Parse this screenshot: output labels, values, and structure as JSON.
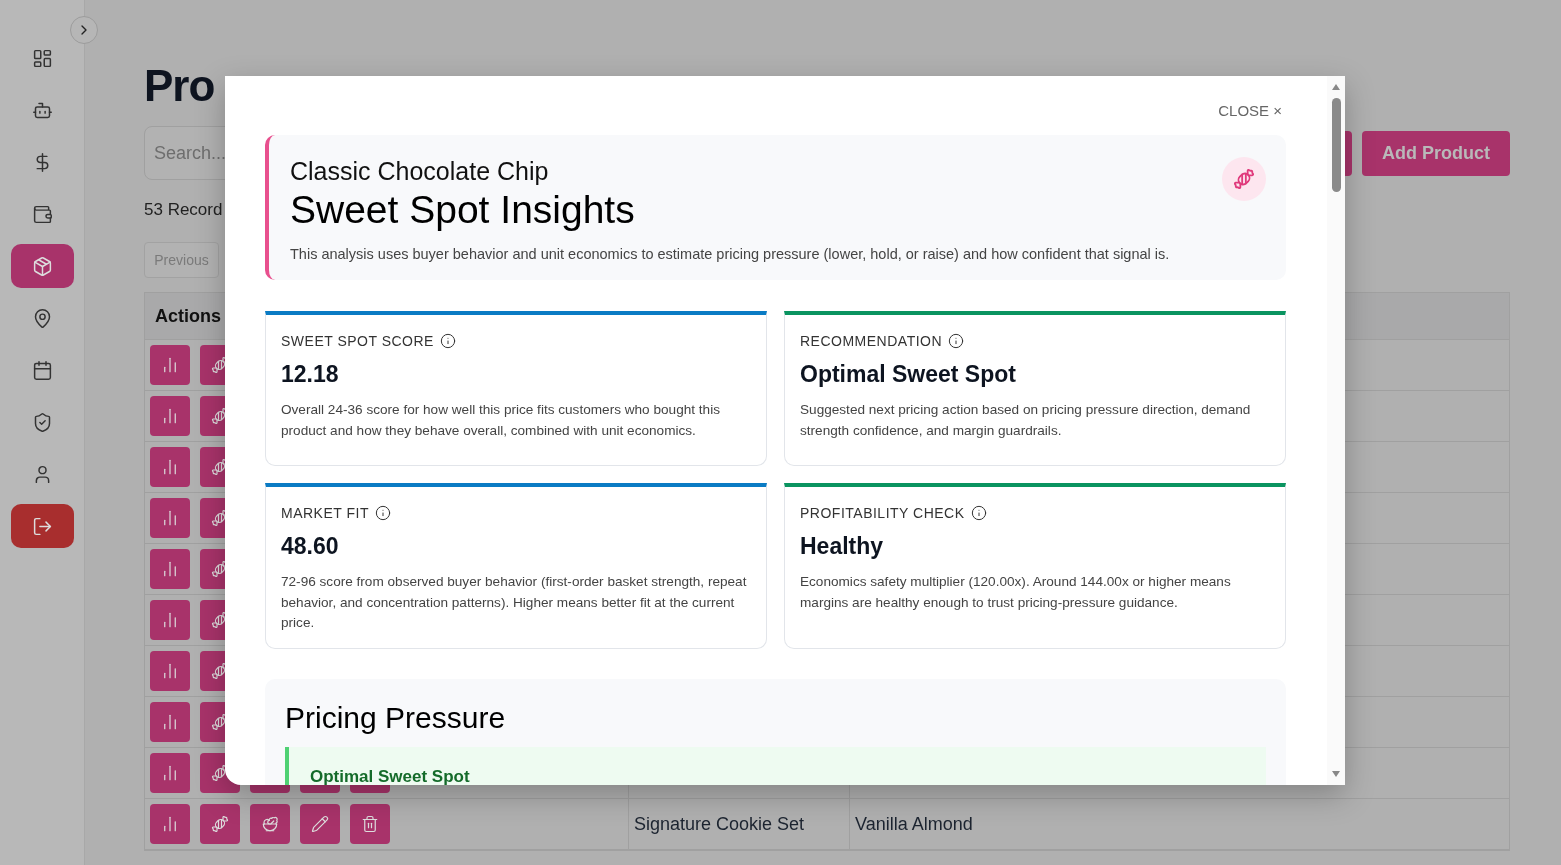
{
  "sidebar": {
    "items": [
      {
        "kind": "nav",
        "selected": false
      },
      {
        "kind": "nav",
        "selected": false
      },
      {
        "kind": "nav",
        "selected": false
      },
      {
        "kind": "nav",
        "selected": false
      },
      {
        "kind": "nav",
        "selected": true
      },
      {
        "kind": "nav",
        "selected": false
      },
      {
        "kind": "nav",
        "selected": false
      },
      {
        "kind": "nav",
        "selected": false
      },
      {
        "kind": "nav",
        "selected": false
      },
      {
        "kind": "logout"
      }
    ]
  },
  "page": {
    "title": "Pro",
    "search": {
      "placeholder": "Search..."
    },
    "record_count": "53 Record",
    "previous_button": "Previous",
    "add_button": "Add Product"
  },
  "table": {
    "columns": [
      "Actions"
    ],
    "rows": [
      {},
      {},
      {},
      {},
      {},
      {},
      {},
      {},
      {},
      {
        "column_2": "Signature Cookie Set",
        "column_3": "Vanilla Almond"
      }
    ]
  },
  "modal": {
    "close": "CLOSE ×",
    "product": "Classic Chocolate Chip",
    "title": "Sweet Spot Insights",
    "description": "This analysis uses buyer behavior and unit economics to estimate pricing pressure (lower, hold, or raise) and how confident that signal is.",
    "cards": [
      {
        "label": "SWEET SPOT SCORE",
        "value": "12.18",
        "color": "#0a7bc4",
        "description": "Overall 24-36 score for how well this price fits customers who bought this product and how they behave overall, combined with unit economics."
      },
      {
        "label": "RECOMMENDATION",
        "value": "Optimal Sweet Spot",
        "color": "#0a9460",
        "description": "Suggested next pricing action based on pricing pressure direction, demand strength confidence, and margin guardrails."
      },
      {
        "label": "MARKET FIT",
        "value": "48.60",
        "color": "#0a7bc4",
        "description": "72-96 score from observed buyer behavior (first-order basket strength, repeat behavior, and concentration patterns). Higher means better fit at the current price."
      },
      {
        "label": "PROFITABILITY CHECK",
        "value": "Healthy",
        "color": "#0a9460",
        "description": "Economics safety multiplier (120.00x). Around 144.00x or higher means margins are healthy enough to trust pricing-pressure guidance."
      }
    ],
    "pricing_pressure": {
      "title": "Pricing Pressure",
      "status": "Optimal Sweet Spot"
    }
  }
}
